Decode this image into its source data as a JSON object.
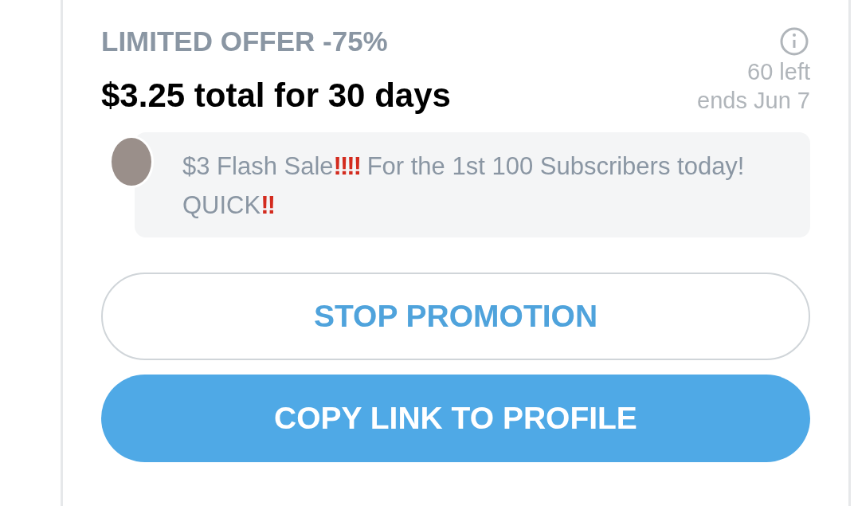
{
  "offer": {
    "label": "LIMITED OFFER -75%",
    "price": "$3.25 total for 30 days",
    "remaining": "60 left",
    "ends": "ends Jun 7"
  },
  "message": {
    "parts": [
      {
        "kind": "text",
        "text": "$3 Flash Sale"
      },
      {
        "kind": "emoji",
        "text": "‼‼"
      },
      {
        "kind": "text",
        "text": " For the 1st 100 Subscribers today! QUICK"
      },
      {
        "kind": "emoji",
        "text": "‼"
      }
    ]
  },
  "buttons": [
    {
      "label": "STOP PROMOTION",
      "kind": "outline"
    },
    {
      "label": "COPY LINK TO PROFILE",
      "kind": "filled"
    }
  ]
}
